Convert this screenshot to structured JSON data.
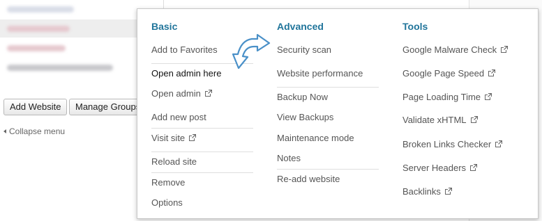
{
  "sidebar": {
    "add_website_label": "Add Website",
    "manage_groups_label": "Manage Groups",
    "collapse_label": "Collapse menu"
  },
  "menu": {
    "basic": {
      "heading": "Basic",
      "items": {
        "add_to_favorites": "Add to Favorites",
        "open_admin_here": "Open admin here",
        "open_admin": "Open admin",
        "add_new_post": "Add new post",
        "visit_site": "Visit site",
        "reload_site": "Reload site",
        "remove": "Remove",
        "options": "Options"
      }
    },
    "advanced": {
      "heading": "Advanced",
      "items": {
        "security_scan": "Security scan",
        "website_performance": "Website performance",
        "backup_now": "Backup Now",
        "view_backups": "View Backups",
        "maintenance_mode": "Maintenance mode",
        "notes": "Notes",
        "re_add_website": "Re-add website"
      }
    },
    "tools": {
      "heading": "Tools",
      "items": {
        "google_malware_check": "Google Malware Check",
        "google_page_speed": "Google Page Speed",
        "page_loading_time": "Page Loading Time",
        "validate_xhtml": "Validate xHTML",
        "broken_links_checker": "Broken Links Checker",
        "server_headers": "Server Headers",
        "backlinks": "Backlinks"
      }
    }
  },
  "colors": {
    "heading": "#21759b",
    "text": "#555555",
    "arrow": "#4a90c8"
  },
  "icons": {
    "external_link": "external-link-icon",
    "collapse": "triangle-left-icon",
    "annotation": "arrow-icon"
  }
}
